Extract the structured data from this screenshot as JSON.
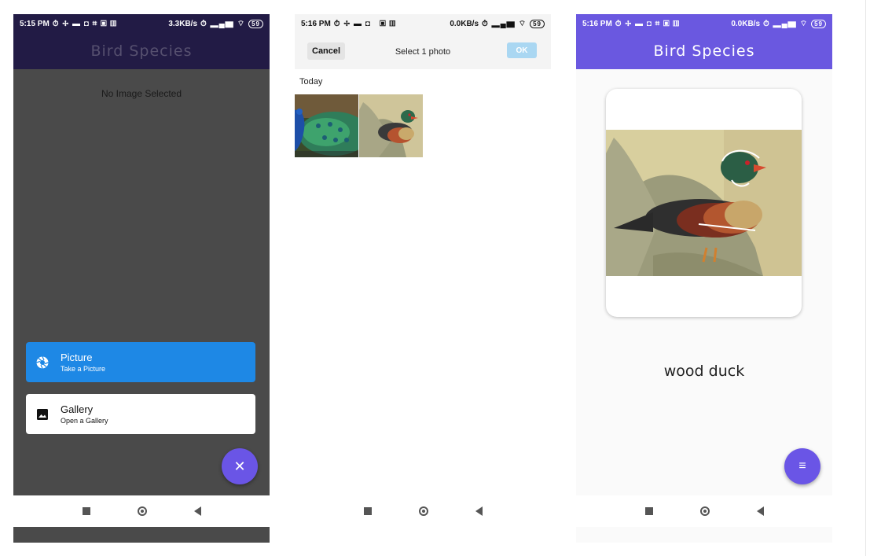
{
  "screen1": {
    "status": {
      "time": "5:15 PM",
      "net": "3.3KB/s",
      "battery": "59"
    },
    "app_title": "Bird Species",
    "empty_message": "No Image Selected",
    "options": [
      {
        "title": "Picture",
        "subtitle": "Take a Picture",
        "icon": "camera-shutter-icon"
      },
      {
        "title": "Gallery",
        "subtitle": "Open a Gallery",
        "icon": "image-icon"
      }
    ],
    "fab_icon": "close-icon",
    "fab_glyph": "✕"
  },
  "screen2": {
    "status": {
      "time": "5:16 PM",
      "net": "0.0KB/s",
      "battery": "59"
    },
    "cancel_label": "Cancel",
    "title": "Select 1 photo",
    "ok_label": "OK",
    "section_label": "Today",
    "thumbnails": [
      "peacock-photo",
      "wood-duck-photo"
    ]
  },
  "screen3": {
    "status": {
      "time": "5:16 PM",
      "net": "0.0KB/s",
      "battery": "59"
    },
    "app_title": "Bird Species",
    "result_label": "wood duck",
    "fab_icon": "menu-icon",
    "fab_glyph": "≡"
  },
  "colors": {
    "dark_appbar": "#221b45",
    "accent": "#6a55e6",
    "picture_button": "#1e88e5",
    "ok_disabled": "#aad7f2"
  }
}
